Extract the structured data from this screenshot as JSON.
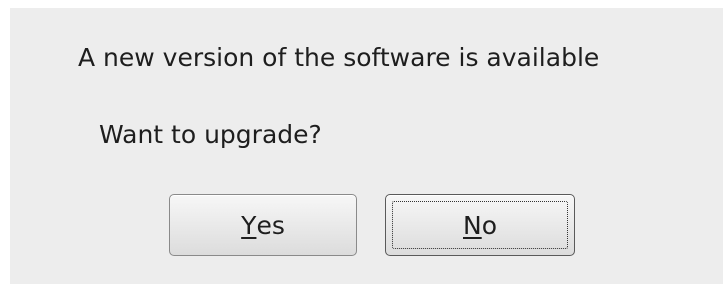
{
  "dialog": {
    "message": "A new version of the software is available",
    "question": "Want to upgrade?",
    "buttons": {
      "yes": {
        "mnemonic": "Y",
        "rest": "es"
      },
      "no": {
        "mnemonic": "N",
        "rest": "o"
      }
    }
  }
}
